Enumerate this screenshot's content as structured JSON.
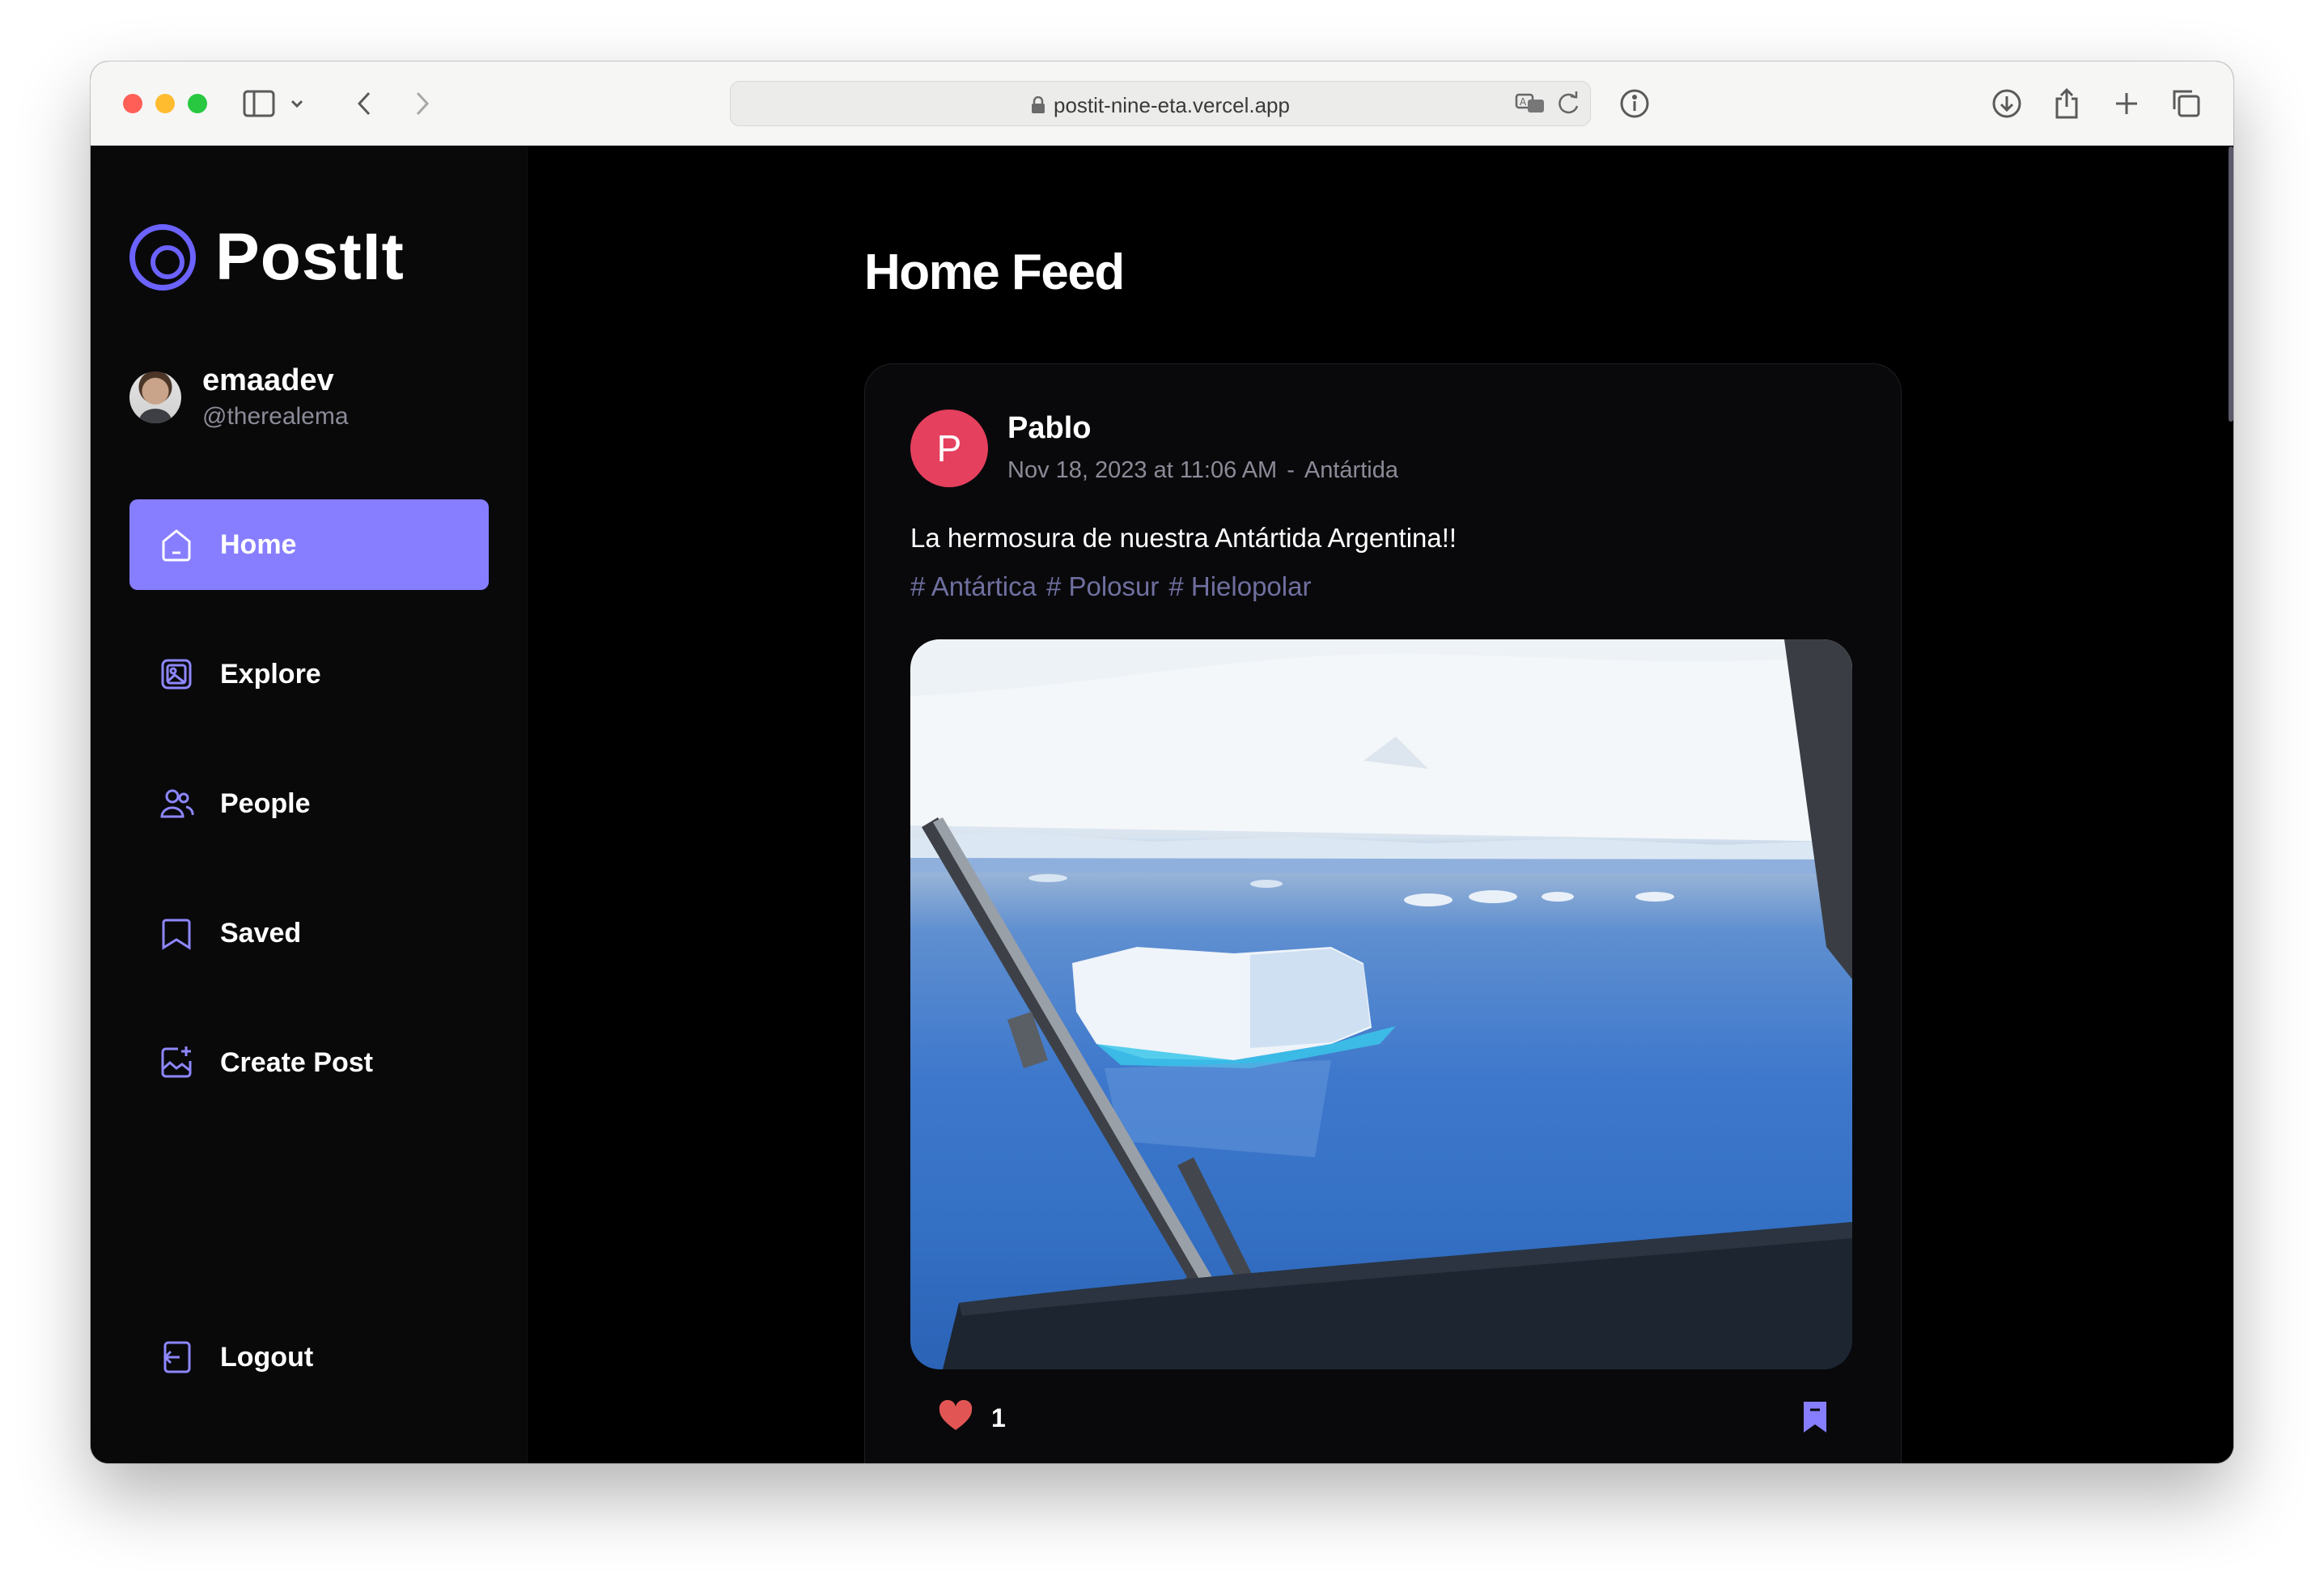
{
  "browser": {
    "url": "postit-nine-eta.vercel.app"
  },
  "app": {
    "logo_text": "PostIt",
    "profile": {
      "name": "emaadev",
      "handle": "@therealema"
    },
    "nav": [
      {
        "label": "Home",
        "icon": "home-icon",
        "active": true
      },
      {
        "label": "Explore",
        "icon": "explore-icon",
        "active": false
      },
      {
        "label": "People",
        "icon": "people-icon",
        "active": false
      },
      {
        "label": "Saved",
        "icon": "saved-icon",
        "active": false
      },
      {
        "label": "Create Post",
        "icon": "create-post-icon",
        "active": false
      }
    ],
    "logout_label": "Logout",
    "accent_color": "#877eff"
  },
  "feed": {
    "title": "Home Feed",
    "post": {
      "avatar_letter": "P",
      "author": "Pablo",
      "date": "Nov 18, 2023 at 11:06 AM",
      "separator": "-",
      "location": "Antártida",
      "caption": "La hermosura de nuestra Antártida Argentina!!",
      "tags": [
        "# Antártica",
        "# Polosur",
        "# Hielopolar"
      ],
      "likes": "1"
    }
  }
}
